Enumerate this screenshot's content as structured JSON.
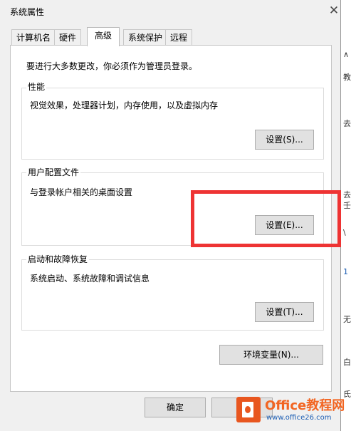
{
  "window": {
    "title": "系统属性",
    "close_glyph": "✕"
  },
  "tabs": [
    {
      "label": "计算机名"
    },
    {
      "label": "硬件"
    },
    {
      "label": "高级"
    },
    {
      "label": "系统保护"
    },
    {
      "label": "远程"
    }
  ],
  "notice": "要进行大多数更改，你必须作为管理员登录。",
  "performance": {
    "title": "性能",
    "desc": "视觉效果，处理器计划，内存使用，以及虚拟内存",
    "button": "设置(S)..."
  },
  "profiles": {
    "title": "用户配置文件",
    "desc": "与登录帐户相关的桌面设置",
    "button": "设置(E)..."
  },
  "startup": {
    "title": "启动和故障恢复",
    "desc": "系统启动、系统故障和调试信息",
    "button": "设置(T)..."
  },
  "env_button": "环境变量(N)...",
  "footer": {
    "ok": "确定"
  },
  "watermark": {
    "brand": "Office教程网",
    "url": "www.office26.com"
  },
  "colors": {
    "highlight": "#ee3333",
    "brand": "#f26522"
  }
}
